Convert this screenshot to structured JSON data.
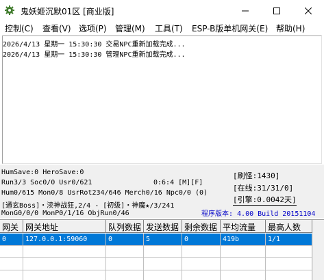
{
  "window": {
    "title": "鬼妖姬沉默01区 [商业版]"
  },
  "menu": [
    "控制(C)",
    "查看(V)",
    "选项(P)",
    "管理(M)",
    "工具(T)",
    "ESP-B版单机网关(E)",
    "帮助(H)"
  ],
  "log": [
    "2026/4/13 星期一 15:30:30 交易NPC重新加载完成...",
    "2026/4/13 星期一 15:30:30 管理NPC重新加载完成..."
  ],
  "status": {
    "line1": "HumSave:0 HeroSave:0",
    "line2": "Run3/3 Soc0/0 Usr0/621",
    "timer": "0:6:4 [M][F]",
    "line3": "Hum0/615 Mon0/8 UsrRot234/646 Merch0/16 Npc0/0 (0)",
    "line4": "[通玄Boss]・渎神战狂,2/4 - [初级]・神魔★/3/241",
    "line5": "MonG0/0/0 MonP0/1/16 ObjRun0/46",
    "refresh": "[刷怪:1430]",
    "online": "[在线:31/31/0]",
    "engine": "[引擎:0.0042天]",
    "version": "程序版本: 4.00 Build 20151104"
  },
  "grid": {
    "columns": [
      "网关",
      "网关地址",
      "队列数据",
      "发送数据",
      "剩余数据",
      "平均流量",
      "最高人数"
    ],
    "rows": [
      [
        "0",
        "127.0.0.1:59060",
        "0",
        "5",
        "0",
        "419b",
        "1/1"
      ]
    ]
  }
}
